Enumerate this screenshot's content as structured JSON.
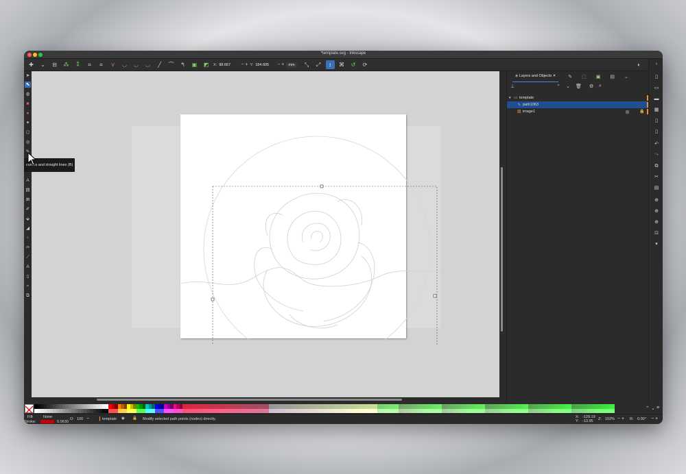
{
  "window": {
    "title": "*template.svg - Inkscape"
  },
  "controls": {
    "x_label": "X:",
    "x_value": "98.667",
    "y_label": "Y:",
    "y_value": "184.605",
    "unit": "mm"
  },
  "tooltip": {
    "text": "curves and straight lines (B)"
  },
  "dock": {
    "active_tab": "Layers and Objects",
    "tree": [
      {
        "label": "template",
        "type": "layer"
      },
      {
        "label": "path1063",
        "type": "path"
      },
      {
        "label": "image1",
        "type": "image"
      }
    ]
  },
  "status": {
    "fill_label": "Fill:",
    "fill_value": "None",
    "stroke_label": "Stroke:",
    "stroke_width": "0.0630",
    "opacity_label": "O:",
    "opacity_value": "100",
    "layer": "template",
    "message": "Modify selected path points (nodes) directly.",
    "cursor_x_label": "X:",
    "cursor_x": "-129.19",
    "cursor_y_label": "Y:",
    "cursor_y": "-13.95",
    "zoom_label": "Z:",
    "zoom": "102%",
    "rotate_label": "R:",
    "rotate": "0.00°"
  },
  "colors": {
    "accent": "#3b6fb6",
    "selection": "#1f4f8f",
    "layer_marker": "#e8913a",
    "stroke_red": "#cc0000"
  },
  "icons": {
    "tools": [
      "selector-icon",
      "node-icon",
      "tweak-icon",
      "rect-icon",
      "ellipse-icon",
      "star-icon",
      "3dbox-icon",
      "spiral-icon",
      "pen-icon",
      "pencil-icon",
      "calligraphy-icon",
      "text-icon",
      "gradient-icon",
      "mesh-icon",
      "dropper-icon",
      "paint-bucket-icon",
      "eraser-icon",
      "spray-icon",
      "connector-icon",
      "measure-icon",
      "lpe-icon",
      "zoom-icon",
      "pages-icon"
    ]
  }
}
